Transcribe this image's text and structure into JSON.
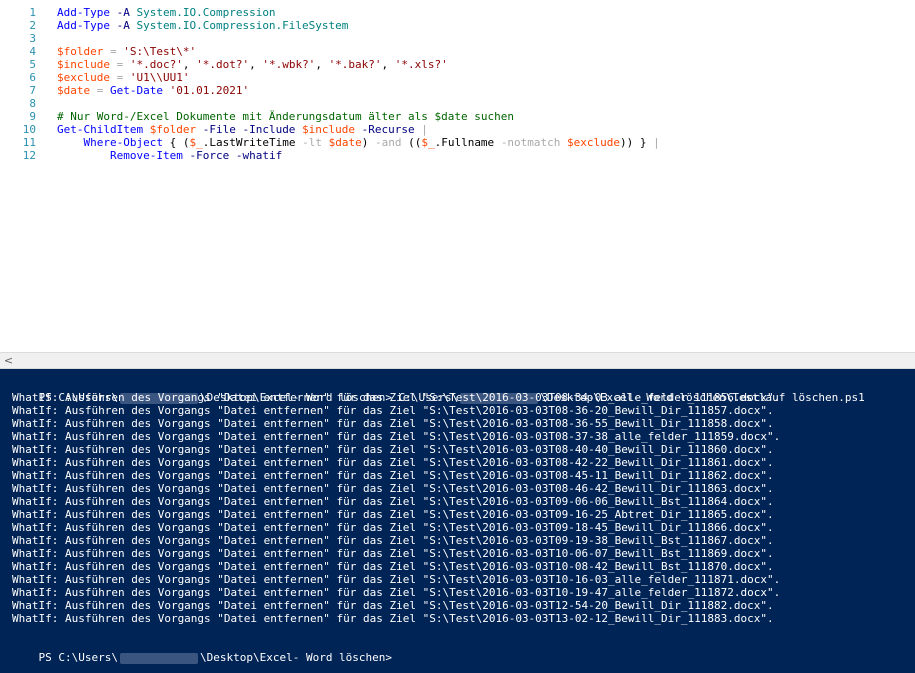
{
  "editor": {
    "lines": [
      {
        "n": "1",
        "tokens": [
          [
            "c-cmd",
            "Add-Type"
          ],
          [
            "c-plain",
            " "
          ],
          [
            "c-par",
            "-A"
          ],
          [
            "c-plain",
            " "
          ],
          [
            "c-type",
            "System.IO.Compression"
          ]
        ]
      },
      {
        "n": "2",
        "tokens": [
          [
            "c-cmd",
            "Add-Type"
          ],
          [
            "c-plain",
            " "
          ],
          [
            "c-par",
            "-A"
          ],
          [
            "c-plain",
            " "
          ],
          [
            "c-type",
            "System.IO.Compression.FileSystem"
          ]
        ]
      },
      {
        "n": "3",
        "tokens": []
      },
      {
        "n": "4",
        "tokens": [
          [
            "c-var",
            "$folder"
          ],
          [
            "c-plain",
            " "
          ],
          [
            "c-op",
            "="
          ],
          [
            "c-plain",
            " "
          ],
          [
            "c-str",
            "'S:\\Test\\*'"
          ]
        ]
      },
      {
        "n": "5",
        "tokens": [
          [
            "c-var",
            "$include"
          ],
          [
            "c-plain",
            " "
          ],
          [
            "c-op",
            "="
          ],
          [
            "c-plain",
            " "
          ],
          [
            "c-str",
            "'*.doc?'"
          ],
          [
            "c-plain",
            ", "
          ],
          [
            "c-str",
            "'*.dot?'"
          ],
          [
            "c-plain",
            ", "
          ],
          [
            "c-str",
            "'*.wbk?'"
          ],
          [
            "c-plain",
            ", "
          ],
          [
            "c-str",
            "'*.bak?'"
          ],
          [
            "c-plain",
            ", "
          ],
          [
            "c-str",
            "'*.xls?'"
          ]
        ]
      },
      {
        "n": "6",
        "tokens": [
          [
            "c-var",
            "$exclude"
          ],
          [
            "c-plain",
            " "
          ],
          [
            "c-op",
            "="
          ],
          [
            "c-plain",
            " "
          ],
          [
            "c-str",
            "'U1\\\\UU1'"
          ]
        ]
      },
      {
        "n": "7",
        "tokens": [
          [
            "c-var",
            "$date"
          ],
          [
            "c-plain",
            " "
          ],
          [
            "c-op",
            "="
          ],
          [
            "c-plain",
            " "
          ],
          [
            "c-cmd",
            "Get-Date"
          ],
          [
            "c-plain",
            " "
          ],
          [
            "c-str",
            "'01.01.2021'"
          ]
        ]
      },
      {
        "n": "8",
        "tokens": []
      },
      {
        "n": "9",
        "tokens": [
          [
            "c-com",
            "# Nur Word-/Excel Dokumente mit Änderungsdatum älter als $date suchen"
          ]
        ]
      },
      {
        "n": "10",
        "tokens": [
          [
            "c-cmd",
            "Get-ChildItem"
          ],
          [
            "c-plain",
            " "
          ],
          [
            "c-var",
            "$folder"
          ],
          [
            "c-plain",
            " "
          ],
          [
            "c-par",
            "-File"
          ],
          [
            "c-plain",
            " "
          ],
          [
            "c-par",
            "-Include"
          ],
          [
            "c-plain",
            " "
          ],
          [
            "c-var",
            "$include"
          ],
          [
            "c-plain",
            " "
          ],
          [
            "c-par",
            "-Recurse"
          ],
          [
            "c-plain",
            " "
          ],
          [
            "c-op",
            "|"
          ]
        ]
      },
      {
        "n": "11",
        "tokens": [
          [
            "c-plain",
            "    "
          ],
          [
            "c-cmd",
            "Where-Object"
          ],
          [
            "c-plain",
            " { ("
          ],
          [
            "c-var",
            "$_"
          ],
          [
            "c-plain",
            ".LastWriteTime "
          ],
          [
            "c-op",
            "-lt"
          ],
          [
            "c-plain",
            " "
          ],
          [
            "c-var",
            "$date"
          ],
          [
            "c-plain",
            ") "
          ],
          [
            "c-op",
            "-and"
          ],
          [
            "c-plain",
            " (("
          ],
          [
            "c-var",
            "$_"
          ],
          [
            "c-plain",
            ".Fullname "
          ],
          [
            "c-op",
            "-notmatch"
          ],
          [
            "c-plain",
            " "
          ],
          [
            "c-var",
            "$exclude"
          ],
          [
            "c-plain",
            ")) } "
          ],
          [
            "c-op",
            "|"
          ]
        ]
      },
      {
        "n": "12",
        "tokens": [
          [
            "c-plain",
            "        "
          ],
          [
            "c-cmd",
            "Remove-Item"
          ],
          [
            "c-plain",
            " "
          ],
          [
            "c-par",
            "-Force"
          ],
          [
            "c-plain",
            " "
          ],
          [
            "c-par",
            "-whatif"
          ]
        ]
      }
    ]
  },
  "scrollbar": {
    "left_arrow": "<"
  },
  "console": {
    "prompt_prefix": "PS C:\\Users\\",
    "prompt_suffix": "\\Desktop\\Excel- Word löschen> ",
    "command_prefix": "C:\\Users\\",
    "command_suffix": "\\Desktop\\Excel- Word löschen\\Testlauf löschen.ps1",
    "output": [
      "WhatIf: Ausführen des Vorgangs \"Datei entfernen\" für das Ziel \"S:\\Test\\2016-03-03T08-34-03_alle_felder_111856.docx\".",
      "WhatIf: Ausführen des Vorgangs \"Datei entfernen\" für das Ziel \"S:\\Test\\2016-03-03T08-36-20_Bewill_Dir_111857.docx\".",
      "WhatIf: Ausführen des Vorgangs \"Datei entfernen\" für das Ziel \"S:\\Test\\2016-03-03T08-36-55_Bewill_Dir_111858.docx\".",
      "WhatIf: Ausführen des Vorgangs \"Datei entfernen\" für das Ziel \"S:\\Test\\2016-03-03T08-37-38_alle_felder_111859.docx\".",
      "WhatIf: Ausführen des Vorgangs \"Datei entfernen\" für das Ziel \"S:\\Test\\2016-03-03T08-40-40_Bewill_Dir_111860.docx\".",
      "WhatIf: Ausführen des Vorgangs \"Datei entfernen\" für das Ziel \"S:\\Test\\2016-03-03T08-42-22_Bewill_Dir_111861.docx\".",
      "WhatIf: Ausführen des Vorgangs \"Datei entfernen\" für das Ziel \"S:\\Test\\2016-03-03T08-45-11_Bewill_Dir_111862.docx\".",
      "WhatIf: Ausführen des Vorgangs \"Datei entfernen\" für das Ziel \"S:\\Test\\2016-03-03T08-46-42_Bewill_Dir_111863.docx\".",
      "WhatIf: Ausführen des Vorgangs \"Datei entfernen\" für das Ziel \"S:\\Test\\2016-03-03T09-06-06_Bewill_Bst_111864.docx\".",
      "WhatIf: Ausführen des Vorgangs \"Datei entfernen\" für das Ziel \"S:\\Test\\2016-03-03T09-16-25_Abtret_Dir_111865.docx\".",
      "WhatIf: Ausführen des Vorgangs \"Datei entfernen\" für das Ziel \"S:\\Test\\2016-03-03T09-18-45_Bewill_Dir_111866.docx\".",
      "WhatIf: Ausführen des Vorgangs \"Datei entfernen\" für das Ziel \"S:\\Test\\2016-03-03T09-19-38_Bewill_Bst_111867.docx\".",
      "WhatIf: Ausführen des Vorgangs \"Datei entfernen\" für das Ziel \"S:\\Test\\2016-03-03T10-06-07_Bewill_Bst_111869.docx\".",
      "WhatIf: Ausführen des Vorgangs \"Datei entfernen\" für das Ziel \"S:\\Test\\2016-03-03T10-08-42_Bewill_Bst_111870.docx\".",
      "WhatIf: Ausführen des Vorgangs \"Datei entfernen\" für das Ziel \"S:\\Test\\2016-03-03T10-16-03_alle_felder_111871.docx\".",
      "WhatIf: Ausführen des Vorgangs \"Datei entfernen\" für das Ziel \"S:\\Test\\2016-03-03T10-19-47_alle_felder_111872.docx\".",
      "WhatIf: Ausführen des Vorgangs \"Datei entfernen\" für das Ziel \"S:\\Test\\2016-03-03T12-54-20_Bewill_Dir_111882.docx\".",
      "WhatIf: Ausführen des Vorgangs \"Datei entfernen\" für das Ziel \"S:\\Test\\2016-03-03T13-02-12_Bewill_Dir_111883.docx\"."
    ]
  }
}
